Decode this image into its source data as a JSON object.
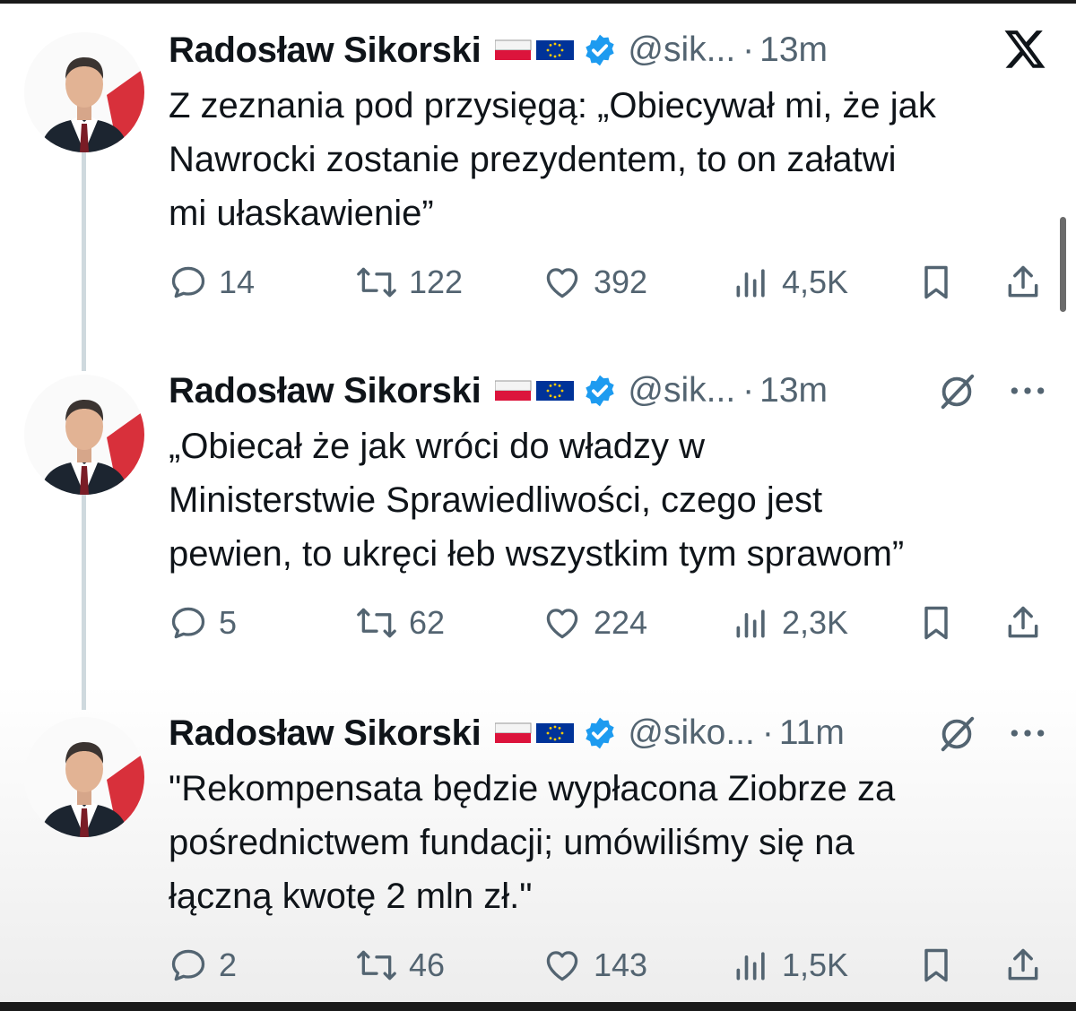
{
  "tweets": [
    {
      "name": "Radosław Sikorski",
      "handle": "@sik...",
      "dot": "·",
      "time": "13m",
      "text": "Z zeznania pod przysięgą: „Obiecywał mi, że jak\nNawrocki zostanie prezydentem, to on załatwi\nmi ułaskawienie”",
      "replies": "14",
      "reposts": "122",
      "likes": "392",
      "views": "4,5K"
    },
    {
      "name": "Radosław Sikorski",
      "handle": "@sik...",
      "dot": "·",
      "time": "13m",
      "text": "„Obiecał że jak wróci do władzy w\nMinisterstwie Sprawiedliwości, czego jest\npewien, to ukręci łeb wszystkim tym sprawom”",
      "replies": "5",
      "reposts": "62",
      "likes": "224",
      "views": "2,3K"
    },
    {
      "name": "Radosław Sikorski",
      "handle": "@siko...",
      "dot": "·",
      "time": "11m",
      "text": "\"Rekompensata będzie wypłacona Ziobrze za\npośrednictwem fundacji; umówiliśmy się na\nłączną kwotę 2 mln zł.\"",
      "replies": "2",
      "reposts": "46",
      "likes": "143",
      "views": "1,5K"
    }
  ],
  "icons": {
    "logo": "x-logo-icon",
    "grok": "grok-icon",
    "more": "more-icon",
    "verified": "verified-badge-icon",
    "flags": "poland-eu-flags-icon"
  },
  "colors": {
    "text": "#0f1419",
    "secondary": "#536471",
    "verified": "#1d9bf0",
    "thread_line": "#cfd9de"
  }
}
